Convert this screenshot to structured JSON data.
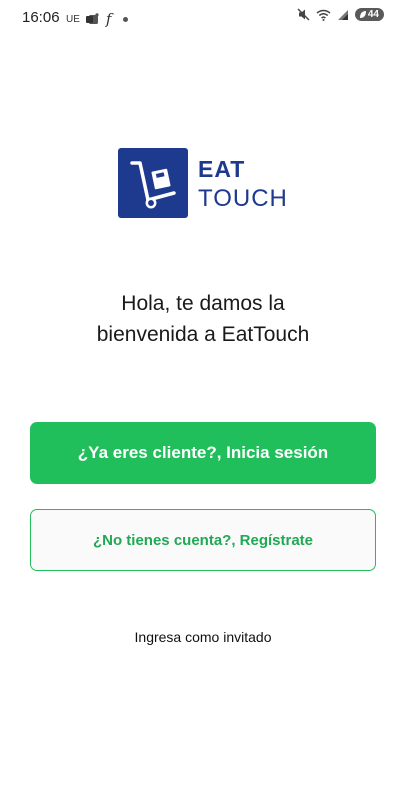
{
  "status_bar": {
    "time": "16:06",
    "left_glyphs": [
      "UE",
      "f"
    ],
    "battery_level": "44"
  },
  "logo": {
    "line1": "EAT",
    "line2": "TOUCH",
    "brand_color": "#1e3a8f"
  },
  "welcome": {
    "line1": "Hola, te damos la",
    "line2": "bienvenida a EatTouch"
  },
  "actions": {
    "login_label": "¿Ya eres cliente?, Inicia sesión",
    "register_label": "¿No tienes cuenta?, Regístrate",
    "guest_label": "Ingresa como invitado"
  },
  "colors": {
    "accent": "#21bf5c"
  }
}
